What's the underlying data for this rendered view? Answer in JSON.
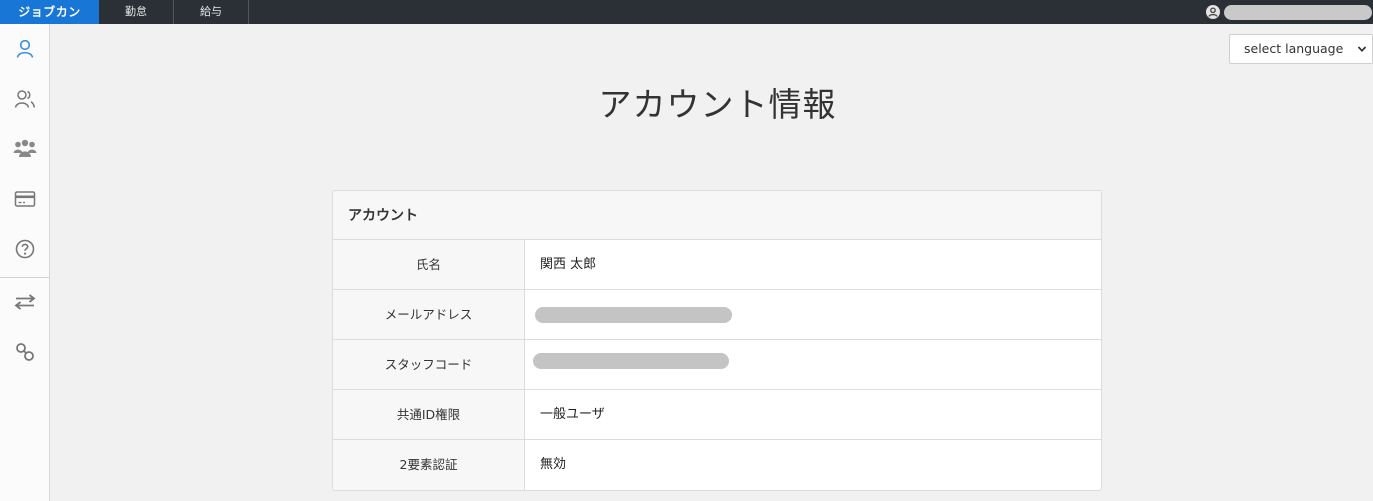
{
  "header": {
    "brand": "ジョブカン",
    "nav": [
      {
        "label": "勤怠"
      },
      {
        "label": "給与"
      }
    ]
  },
  "sidebar": {
    "icons": [
      "user-icon",
      "users-icon",
      "group-icon",
      "credit-card-icon",
      "help-icon",
      "transfer-icon",
      "link-icon"
    ]
  },
  "language": {
    "label": "select language"
  },
  "page": {
    "title": "アカウント情報"
  },
  "account": {
    "header": "アカウント",
    "rows": [
      {
        "label": "氏名",
        "value": "関西 太郎"
      },
      {
        "label": "メールアドレス",
        "value": ""
      },
      {
        "label": "スタッフコード",
        "value": ""
      },
      {
        "label": "共通ID権限",
        "value": "一般ユーザ"
      },
      {
        "label": "2要素認証",
        "value": "無効"
      }
    ]
  },
  "colors": {
    "topbar": "#2b3036",
    "brand": "#1876d6",
    "accent": "#3a8fd8"
  }
}
